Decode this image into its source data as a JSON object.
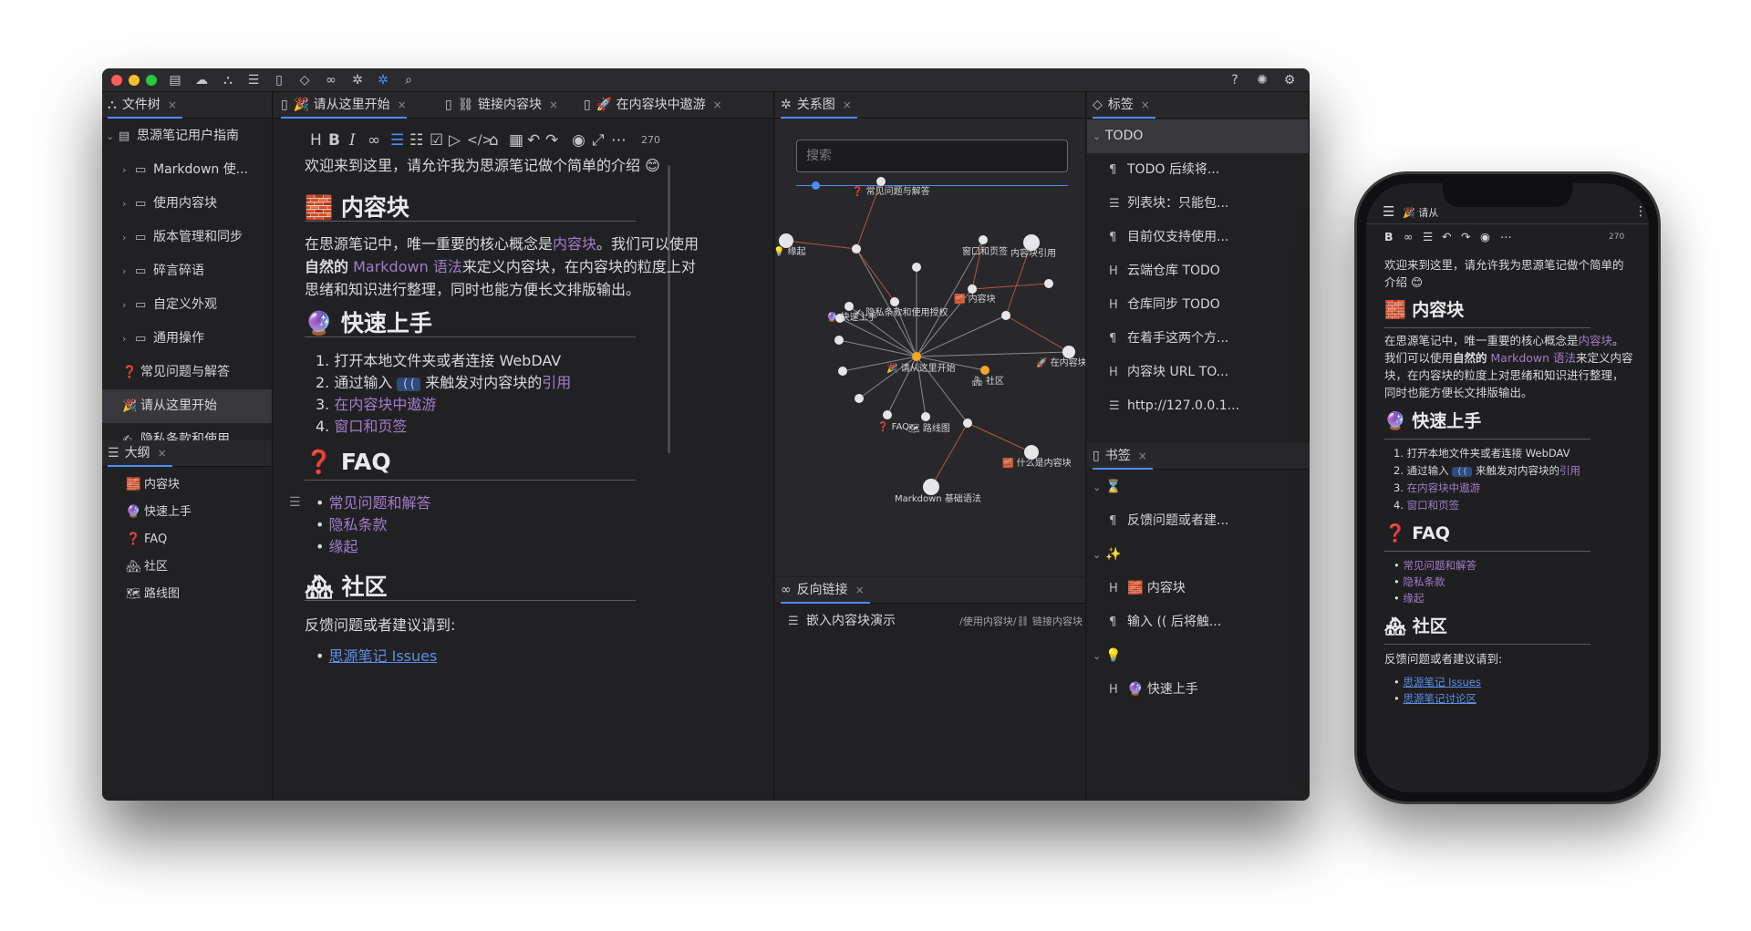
{
  "colors": {
    "accent": "#4c8dff",
    "link": "#a27cc9",
    "graph_node": "#e6e6e8",
    "graph_focus": "#f5a623"
  },
  "toolbar_icons": [
    "doc-icon",
    "cloud-icon",
    "graph-icon",
    "outline-icon",
    "bookmark-icon",
    "tag-icon",
    "link-icon",
    "bug-icon",
    "graph-active-icon",
    "search-icon"
  ],
  "filetree": {
    "tab": "文件树",
    "notebook": "思源笔记用户指南",
    "items": [
      {
        "label": "Markdown 使..."
      },
      {
        "label": "使用内容块"
      },
      {
        "label": "版本管理和同步"
      },
      {
        "label": "碎言碎语"
      },
      {
        "label": "自定义外观"
      },
      {
        "label": "通用操作"
      },
      {
        "label": "常见问题与解答",
        "emoji": "❓"
      },
      {
        "label": "请从这里开始",
        "emoji": "🎉"
      },
      {
        "label": "隐私条款和使用...",
        "emoji": "✍"
      }
    ]
  },
  "outline": {
    "tab": "大纲",
    "items": [
      {
        "label": "内容块",
        "emoji": "🧱"
      },
      {
        "label": "快速上手",
        "emoji": "🔮"
      },
      {
        "label": "FAQ",
        "emoji": "❓"
      },
      {
        "label": "社区",
        "emoji": "🏘"
      },
      {
        "label": "路线图",
        "emoji": "🗺"
      }
    ]
  },
  "editor": {
    "tabs": [
      {
        "label": "🎉 请从这里开始"
      },
      {
        "label": "⛓ 链接内容块"
      },
      {
        "label": "🚀 在内容块中遨游"
      }
    ],
    "word_count": "270",
    "intro": "欢迎来到这里，请允许我为思源笔记做个简单的介绍 😊",
    "h_block": "🧱 内容块",
    "block_p1a": "在思源笔记中，唯一重要的核心概念是",
    "block_p1_link": "内容块",
    "block_p1b": "。我们可以使用",
    "block_p2_bold": "自然的",
    "block_p2_link": " Markdown 语法",
    "block_p2b": "来定义内容块，在内容块的粒度上对",
    "block_p3": "思绪和知识进行整理，同时也能方便长文排版输出。",
    "h_quick": "🔮 快速上手",
    "quick": {
      "i1": "打开本地文件夹或者连接 WebDAV",
      "i2a": "通过输入 ",
      "i2_code": "((",
      "i2b": " 来触发对内容块的",
      "i2_link": "引用",
      "i3": "在内容块中遨游",
      "i4": "窗口和页签"
    },
    "h_faq": "❓ FAQ",
    "faq": [
      "常见问题和解答",
      "隐私条款",
      "缘起"
    ],
    "h_community": "🏘 社区",
    "community_p": "反馈问题或者建议请到:",
    "community_link": "思源笔记 Issues"
  },
  "graph": {
    "tab": "关系图",
    "search_placeholder": "搜索",
    "labels": {
      "faq": "❓ 常见问题与解答",
      "origin": "💡 缘起",
      "window": "窗口和页签",
      "ref": "内容块引用",
      "privacy": "✍ 隐私条款和使用授权",
      "quick": "🔮 快速上手",
      "block": "🧱 内容块",
      "start": "🎉 请从这里开始",
      "community": "🏘 社区",
      "travel": "🚀 在内容块中",
      "faq2": "❓ FAQ",
      "roadmap": "🗺 路线图",
      "whatblock": "🧱 什么是内容块",
      "md": "Markdown 基础语法"
    }
  },
  "backlinks": {
    "tab": "反向链接",
    "item": "嵌入内容块演示",
    "path": "/使用内容块/⛓ 链接内容块"
  },
  "tags": {
    "tab": "标签",
    "group": "TODO",
    "items": [
      {
        "icon": "¶",
        "label": "TODO 后续将..."
      },
      {
        "icon": "☰",
        "label": "列表块：只能包..."
      },
      {
        "icon": "¶",
        "label": "目前仅支持使用..."
      },
      {
        "icon": "H",
        "label": "云端仓库 TODO"
      },
      {
        "icon": "H",
        "label": "仓库同步 TODO"
      },
      {
        "icon": "¶",
        "label": "在着手这两个方..."
      },
      {
        "icon": "H",
        "label": "内容块 URL TO..."
      },
      {
        "icon": "☰",
        "label": "http://127.0.0.1..."
      }
    ]
  },
  "bookmarks": {
    "tab": "书签",
    "group1": "⌛",
    "item1": "反馈问题或者建...",
    "group2": "✨",
    "item2": "🧱 内容块",
    "item3": "输入 (( 后将触...",
    "group3": "💡",
    "item4": "🔮 快速上手"
  },
  "mobile": {
    "title": "🎉 请从",
    "word_count": "270",
    "intro1": "欢迎来到这里，请允许我为思源笔记做个简单的",
    "intro2": "介绍 😊",
    "h_block": "🧱 内容块",
    "p1a": "在思源笔记中，唯一重要的核心概念是",
    "p1_link": "内容块",
    "p1b": "。",
    "p2a": "我们可以使用",
    "p2_bold": "自然的",
    "p2_link": " Markdown 语法",
    "p2b": "来定义内容",
    "p3": "块，在内容块的粒度上对思绪和知识进行整理，",
    "p4": "同时也能方便长文排版输出。",
    "h_quick": "🔮 快速上手",
    "q1": "打开本地文件夹或者连接 WebDAV",
    "q2a": "通过输入 ",
    "q2_code": "((",
    "q2b": " 来触发对内容块的",
    "q2_link": "引用",
    "q3": "在内容块中遨游",
    "q4": "窗口和页签",
    "h_faq": "❓ FAQ",
    "faq": [
      "常见问题和解答",
      "隐私条款",
      "缘起"
    ],
    "h_community": "🏘 社区",
    "community_p": "反馈问题或者建议请到:",
    "link1": "思源笔记 Issues",
    "link2": "思源笔记讨论区"
  }
}
